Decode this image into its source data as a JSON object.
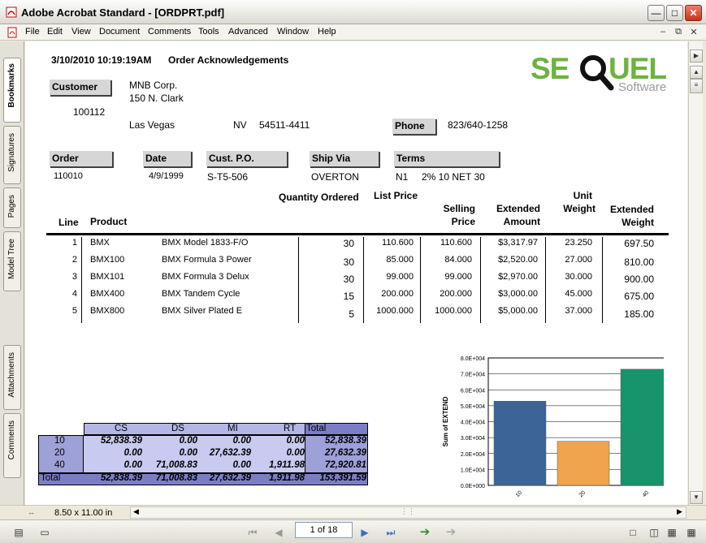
{
  "window": {
    "title": "Adobe Acrobat Standard - [ORDPRT.pdf]"
  },
  "menu": [
    "File",
    "Edit",
    "View",
    "Document",
    "Comments",
    "Tools",
    "Advanced",
    "Window",
    "Help"
  ],
  "side_tabs": [
    "Bookmarks",
    "Signatures",
    "Pages",
    "Model Tree",
    "Attachments",
    "Comments"
  ],
  "report": {
    "datetime": "3/10/2010 10:19:19AM",
    "heading": "Order Acknowledgements",
    "logo_text": "SEQUEL",
    "logo_sub": "Software",
    "customer_label": "Customer",
    "customer_id": "100112",
    "customer_name": "MNB Corp.",
    "address1": "150 N. Clark",
    "city": "Las Vegas",
    "state": "NV",
    "zip": "54511-4411",
    "phone_label": "Phone",
    "phone": "823/640-1258",
    "order_label": "Order",
    "order": "110010",
    "date_label": "Date",
    "date": "4/9/1999",
    "custpo_label": "Cust. P.O.",
    "custpo": "S-T5-506",
    "shipvia_label": "Ship Via",
    "shipvia": "OVERTON",
    "terms_label": "Terms",
    "terms_code": "N1",
    "terms": "2% 10 NET 30",
    "columns": {
      "line": "Line",
      "product": "Product",
      "qty": "Quantity Ordered",
      "list": "List Price",
      "selling1": "Selling",
      "selling2": "Price",
      "ext1": "Extended",
      "ext2": "Amount",
      "unit1": "Unit",
      "unit2": "Weight",
      "extw1": "Extended",
      "extw2": "Weight"
    },
    "rows": [
      {
        "line": "1",
        "product": "BMX",
        "desc": "BMX Model 1833-F/O",
        "qty": "30",
        "list": "110.600",
        "sell": "110.600",
        "ext": "$3,317.97",
        "unitw": "23.250",
        "extw": "697.50"
      },
      {
        "line": "2",
        "product": "BMX100",
        "desc": "BMX Formula 3 Power",
        "qty": "30",
        "list": "85.000",
        "sell": "84.000",
        "ext": "$2,520.00",
        "unitw": "27.000",
        "extw": "810.00"
      },
      {
        "line": "3",
        "product": "BMX101",
        "desc": "BMX Formula 3 Delux",
        "qty": "30",
        "list": "99.000",
        "sell": "99.000",
        "ext": "$2,970.00",
        "unitw": "30.000",
        "extw": "900.00"
      },
      {
        "line": "4",
        "product": "BMX400",
        "desc": "BMX Tandem Cycle",
        "qty": "15",
        "list": "200.000",
        "sell": "200.000",
        "ext": "$3,000.00",
        "unitw": "45.000",
        "extw": "675.00"
      },
      {
        "line": "5",
        "product": "BMX800",
        "desc": "BMX Silver Plated E",
        "qty": "5",
        "list": "1000.000",
        "sell": "1000.000",
        "ext": "$5,000.00",
        "unitw": "37.000",
        "extw": "185.00"
      }
    ]
  },
  "pivot": {
    "columns": [
      "CS",
      "DS",
      "MI",
      "RT",
      "Total"
    ],
    "rows": [
      {
        "label": "10",
        "values": [
          "52,838.39",
          "0.00",
          "0.00",
          "0.00",
          "52,838.39"
        ]
      },
      {
        "label": "20",
        "values": [
          "0.00",
          "0.00",
          "27,632.39",
          "0.00",
          "27,632.39"
        ]
      },
      {
        "label": "40",
        "values": [
          "0.00",
          "71,008.83",
          "0.00",
          "1,911.98",
          "72,920.81"
        ]
      },
      {
        "label": "Total",
        "values": [
          "52,838.39",
          "71,008.83",
          "27,632.39",
          "1,911.98",
          "153,391.59"
        ]
      }
    ]
  },
  "chart_data": {
    "type": "bar",
    "categories": [
      "10",
      "20",
      "40"
    ],
    "values": [
      52838.39,
      27632.39,
      72920.81
    ],
    "colors": [
      "#3d6496",
      "#f0a44e",
      "#17946c"
    ],
    "ylabel": "Sum of EXTEND",
    "ylim": [
      0,
      80000
    ],
    "yticks": [
      "0.0E+000",
      "1.0E+004",
      "2.0E+004",
      "3.0E+004",
      "4.0E+004",
      "5.0E+004",
      "6.0E+004",
      "7.0E+004",
      "8.0E+004"
    ],
    "grid": true
  },
  "status": {
    "page_size": "8.50 x 11.00 in"
  },
  "nav": {
    "page": "1 of 18"
  }
}
